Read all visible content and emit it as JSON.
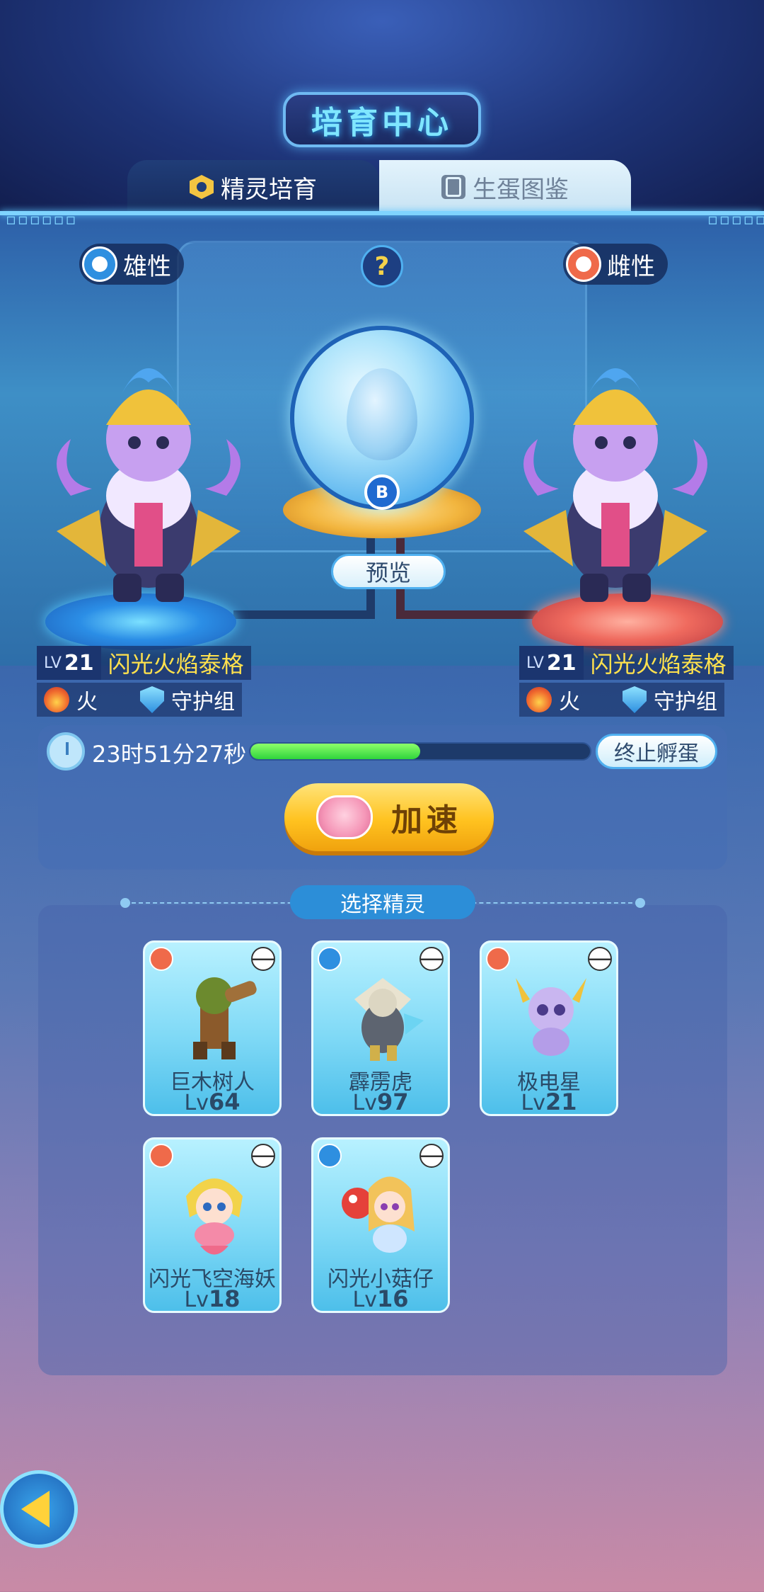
{
  "header": {
    "title": "培育中心",
    "tabs": [
      {
        "label": "精灵培育",
        "active": true,
        "icon": "hexagon-icon"
      },
      {
        "label": "生蛋图鉴",
        "active": false,
        "icon": "egg-book-icon"
      }
    ],
    "side_marks": "▫▫▫▫▫▫"
  },
  "breeding": {
    "male_label": "雄性",
    "female_label": "雌性",
    "help_symbol": "?",
    "egg_badge": "B",
    "preview_label": "预览",
    "left_pet": {
      "lv_prefix": "LV",
      "level": "21",
      "name": "闪光火焰泰格",
      "element": "火",
      "group": "守护组"
    },
    "right_pet": {
      "lv_prefix": "LV",
      "level": "21",
      "name": "闪光火焰泰格",
      "element": "火",
      "group": "守护组"
    }
  },
  "timer": {
    "remaining": "23时51分27秒",
    "progress": 0.5,
    "stop_label": "终止孵蛋",
    "speed_label": "加速"
  },
  "selection": {
    "title": "选择精灵",
    "cards": [
      {
        "name": "巨木树人",
        "lv_prefix": "Lv",
        "level": "64",
        "type": "fire"
      },
      {
        "name": "霹雳虎",
        "lv_prefix": "Lv",
        "level": "97",
        "type": "water"
      },
      {
        "name": "极电星",
        "lv_prefix": "Lv",
        "level": "21",
        "type": "fire"
      },
      {
        "name": "闪光飞空海妖",
        "lv_prefix": "Lv",
        "level": "18",
        "type": "fire"
      },
      {
        "name": "闪光小菇仔",
        "lv_prefix": "Lv",
        "level": "16",
        "type": "water"
      }
    ]
  },
  "colors": {
    "accent": "#7fe6ff",
    "name_yellow": "#ffe14d",
    "progress_green": "#2fd43c",
    "button_yellow": "#ffc21f"
  }
}
